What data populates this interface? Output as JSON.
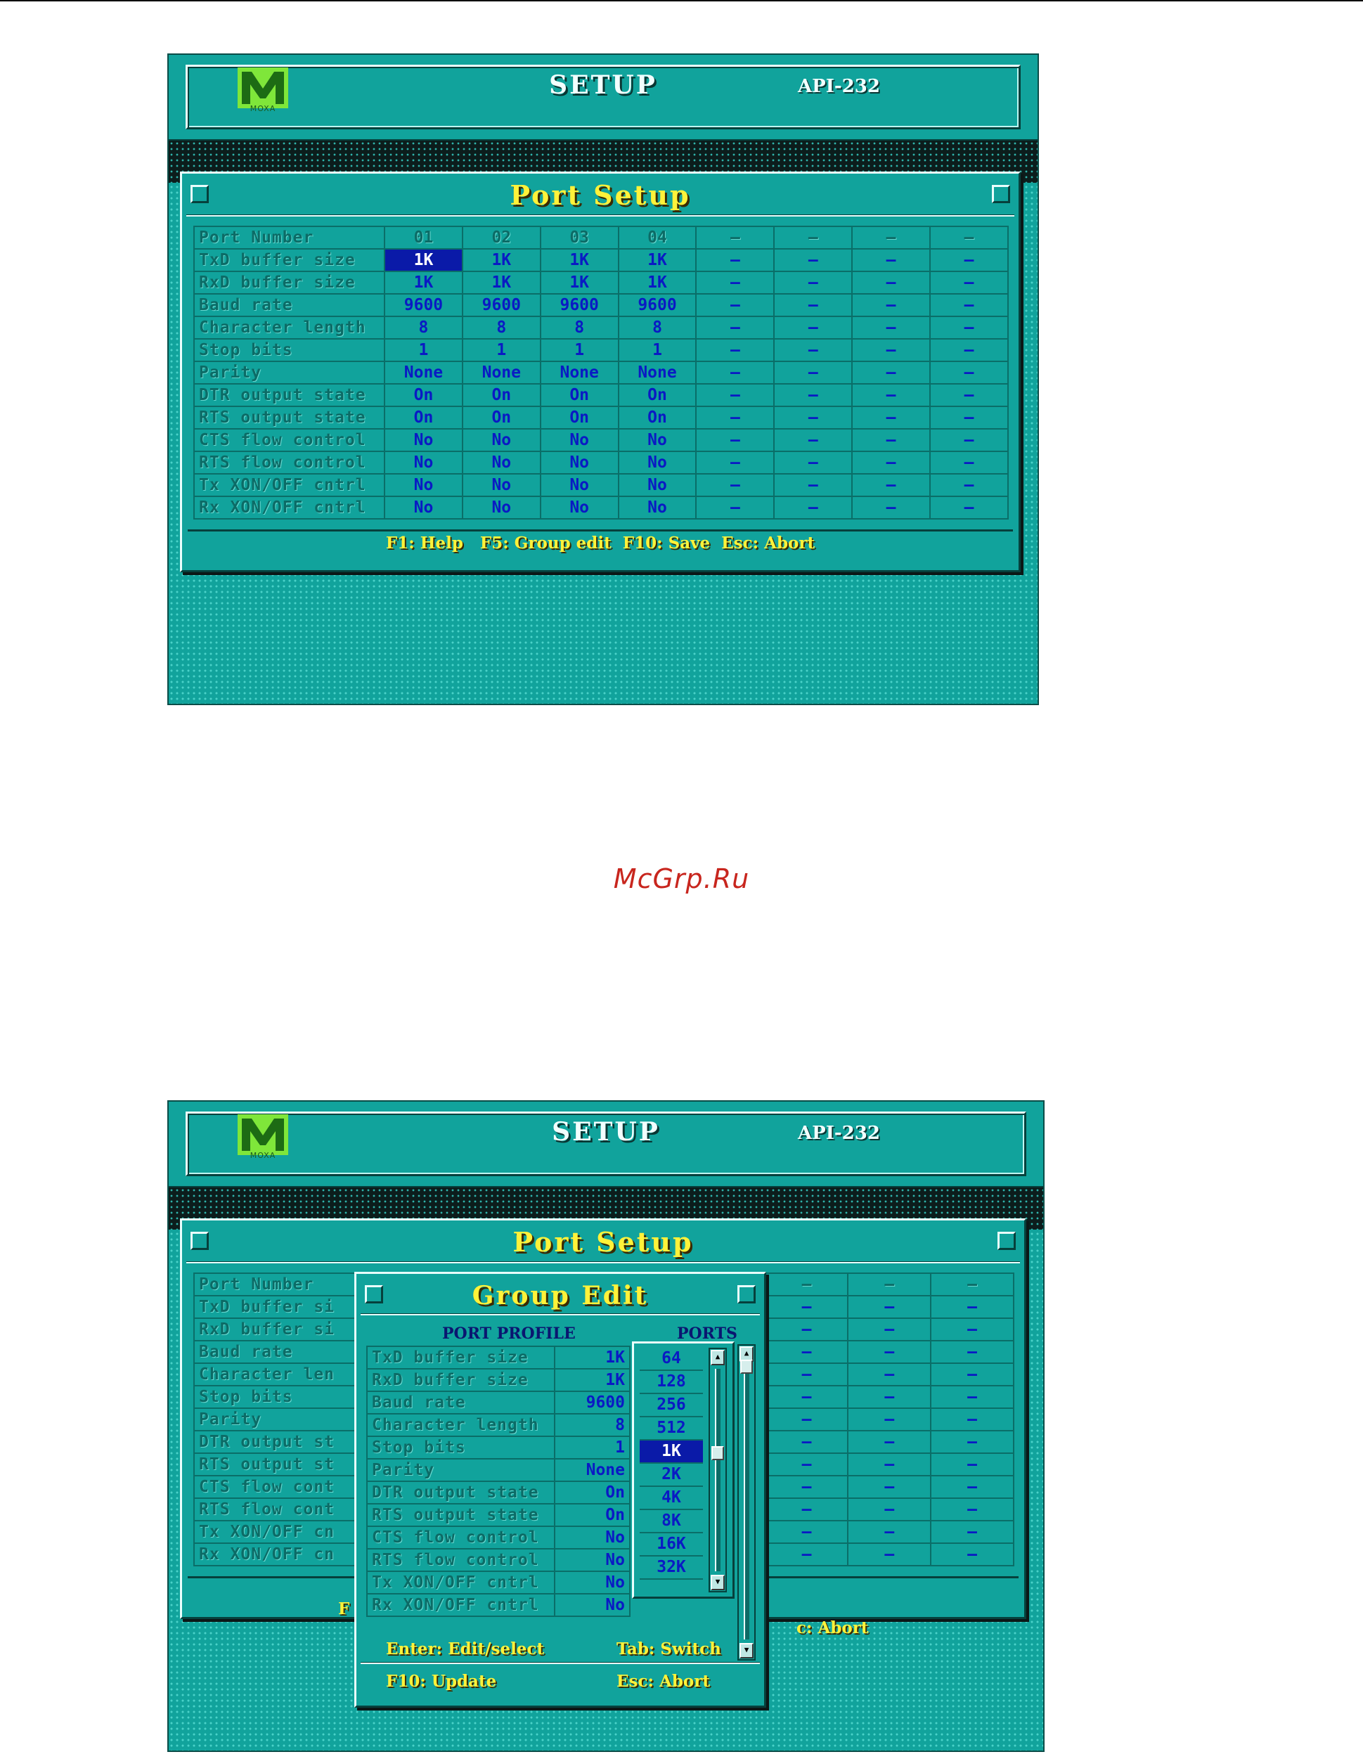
{
  "app": {
    "brand": "MOXA",
    "logo_glyph": "M",
    "setup_title": "SETUP",
    "model": "API-232"
  },
  "colors": {
    "screen_bg": "#11a39c",
    "label_text": "#0c6b66",
    "value_text": "#0a1ac4",
    "selection_bg": "#0a1aa8",
    "title_yellow": "#fff23a"
  },
  "port_setup": {
    "title": "Port Setup",
    "columns": [
      "01",
      "02",
      "03",
      "04",
      "—",
      "—",
      "—",
      "—"
    ],
    "rows": [
      {
        "label": "Port Number",
        "values": []
      },
      {
        "label": "TxD buffer size",
        "values": [
          "1K",
          "1K",
          "1K",
          "1K",
          "—",
          "—",
          "—",
          "—"
        ]
      },
      {
        "label": "RxD buffer size",
        "values": [
          "1K",
          "1K",
          "1K",
          "1K",
          "—",
          "—",
          "—",
          "—"
        ]
      },
      {
        "label": "Baud rate",
        "values": [
          "9600",
          "9600",
          "9600",
          "9600",
          "—",
          "—",
          "—",
          "—"
        ]
      },
      {
        "label": "Character length",
        "values": [
          "8",
          "8",
          "8",
          "8",
          "—",
          "—",
          "—",
          "—"
        ]
      },
      {
        "label": "Stop bits",
        "values": [
          "1",
          "1",
          "1",
          "1",
          "—",
          "—",
          "—",
          "—"
        ]
      },
      {
        "label": "Parity",
        "values": [
          "None",
          "None",
          "None",
          "None",
          "—",
          "—",
          "—",
          "—"
        ]
      },
      {
        "label": "DTR output state",
        "values": [
          "On",
          "On",
          "On",
          "On",
          "—",
          "—",
          "—",
          "—"
        ]
      },
      {
        "label": "RTS output state",
        "values": [
          "On",
          "On",
          "On",
          "On",
          "—",
          "—",
          "—",
          "—"
        ]
      },
      {
        "label": "CTS flow control",
        "values": [
          "No",
          "No",
          "No",
          "No",
          "—",
          "—",
          "—",
          "—"
        ]
      },
      {
        "label": "RTS flow control",
        "values": [
          "No",
          "No",
          "No",
          "No",
          "—",
          "—",
          "—",
          "—"
        ]
      },
      {
        "label": "Tx XON/OFF cntrl",
        "values": [
          "No",
          "No",
          "No",
          "No",
          "—",
          "—",
          "—",
          "—"
        ]
      },
      {
        "label": "Rx XON/OFF cntrl",
        "values": [
          "No",
          "No",
          "No",
          "No",
          "—",
          "—",
          "—",
          "—"
        ]
      }
    ],
    "footer": "F1: Help   F5: Group edit  F10: Save  Esc: Abort"
  },
  "background_screen2": {
    "label_fragments": [
      "Port Number",
      "TxD buffer si",
      "RxD buffer si",
      "Baud rate",
      "Character len",
      "Stop bits",
      "Parity",
      "DTR output st",
      "RTS output st",
      "CTS flow cont",
      "RTS flow cont",
      "Tx XON/OFF cn",
      "Rx XON/OFF cn"
    ],
    "footer_left": "F",
    "footer_right": "c: Abort"
  },
  "group_edit": {
    "title": "Group Edit",
    "profile_header": "PORT PROFILE",
    "ports_header": "PORTS",
    "rows": [
      {
        "label": "TxD buffer size",
        "value": "1K"
      },
      {
        "label": "RxD buffer size",
        "value": "1K"
      },
      {
        "label": "Baud rate",
        "value": "9600"
      },
      {
        "label": "Character length",
        "value": "8"
      },
      {
        "label": "Stop bits",
        "value": "1"
      },
      {
        "label": "Parity",
        "value": "None"
      },
      {
        "label": "DTR output state",
        "value": "On"
      },
      {
        "label": "RTS output state",
        "value": "On"
      },
      {
        "label": "CTS flow control",
        "value": "No"
      },
      {
        "label": "RTS flow control",
        "value": "No"
      },
      {
        "label": "Tx XON/OFF cntrl",
        "value": "No"
      },
      {
        "label": "Rx XON/OFF cntrl",
        "value": "No"
      }
    ],
    "options": [
      "64",
      "128",
      "256",
      "512",
      "1K",
      "2K",
      "4K",
      "8K",
      "16K",
      "32K"
    ],
    "selected_option": "1K",
    "footer": {
      "enter": "Enter: Edit/select",
      "tab": "Tab: Switch",
      "f10": "F10: Update",
      "esc": "Esc: Abort"
    }
  },
  "watermark": "McGrp.Ru"
}
